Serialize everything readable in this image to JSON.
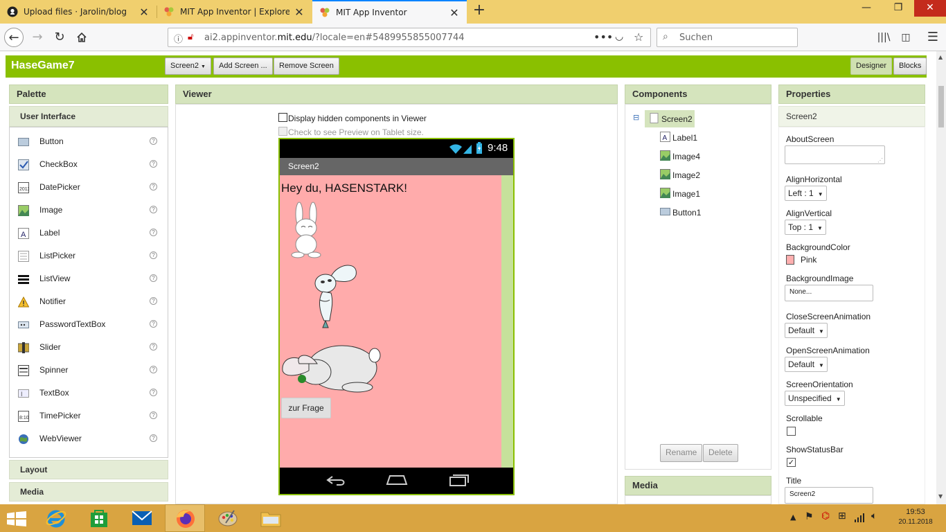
{
  "browser": {
    "tabs": [
      {
        "title": "Upload files · Jarolin/blog",
        "icon": "github-icon"
      },
      {
        "title": "MIT App Inventor | Explore MIT",
        "icon": "appinventor-icon"
      },
      {
        "title": "MIT App Inventor",
        "icon": "appinventor-icon"
      }
    ],
    "url_prefix": "ai2.appinventor.",
    "url_domain": "mit.edu",
    "url_suffix": "/?locale=en#5489955855007744",
    "search_placeholder": "Suchen"
  },
  "app": {
    "project_name": "HaseGame7",
    "screen_dropdown": "Screen2",
    "add_screen": "Add Screen ...",
    "remove_screen": "Remove Screen",
    "designer": "Designer",
    "blocks": "Blocks"
  },
  "palette": {
    "title": "Palette",
    "section": "User Interface",
    "items": [
      {
        "label": "Button",
        "icon": "button-icon"
      },
      {
        "label": "CheckBox",
        "icon": "checkbox-icon"
      },
      {
        "label": "DatePicker",
        "icon": "datepicker-icon"
      },
      {
        "label": "Image",
        "icon": "image-icon"
      },
      {
        "label": "Label",
        "icon": "label-icon"
      },
      {
        "label": "ListPicker",
        "icon": "listpicker-icon"
      },
      {
        "label": "ListView",
        "icon": "listview-icon"
      },
      {
        "label": "Notifier",
        "icon": "notifier-icon"
      },
      {
        "label": "PasswordTextBox",
        "icon": "passwordtextbox-icon"
      },
      {
        "label": "Slider",
        "icon": "slider-icon"
      },
      {
        "label": "Spinner",
        "icon": "spinner-icon"
      },
      {
        "label": "TextBox",
        "icon": "textbox-icon"
      },
      {
        "label": "TimePicker",
        "icon": "timepicker-icon"
      },
      {
        "label": "WebViewer",
        "icon": "webviewer-icon"
      }
    ],
    "help": "?",
    "layout": "Layout",
    "media": "Media"
  },
  "viewer": {
    "title": "Viewer",
    "hidden_components": "Display hidden components in Viewer",
    "tablet_preview": "Check to see Preview on Tablet size.",
    "status_time": "9:48",
    "screen_title": "Screen2",
    "label_text": "Hey du, HASENSTARK!",
    "button_text": "zur Frage"
  },
  "components": {
    "title": "Components",
    "collapse": "⊟",
    "root": "Screen2",
    "children": [
      "Label1",
      "Image4",
      "Image2",
      "Image1",
      "Button1"
    ],
    "rename": "Rename",
    "delete": "Delete",
    "media": "Media"
  },
  "properties": {
    "title": "Properties",
    "component": "Screen2",
    "about_screen": "AboutScreen",
    "align_horizontal": "AlignHorizontal",
    "align_horizontal_value": "Left : 1",
    "align_vertical": "AlignVertical",
    "align_vertical_value": "Top : 1",
    "background_color": "BackgroundColor",
    "background_color_value": "Pink",
    "background_color_hex": "#ffafaf",
    "background_image": "BackgroundImage",
    "background_image_value": "None...",
    "close_animation": "CloseScreenAnimation",
    "close_animation_value": "Default",
    "open_animation": "OpenScreenAnimation",
    "open_animation_value": "Default",
    "orientation": "ScreenOrientation",
    "orientation_value": "Unspecified",
    "scrollable": "Scrollable",
    "scrollable_checked": false,
    "show_status_bar": "ShowStatusBar",
    "show_status_bar_checked": true,
    "title_label": "Title",
    "title_value": "Screen2"
  },
  "taskbar": {
    "time": "19:53",
    "date": "20.11.2018"
  },
  "colors": {
    "accent": "#8ac000",
    "panel_header": "#d5e4bd",
    "screen_bg": "#ffabab",
    "taskbar": "#d9a441",
    "tabbar": "#f0cf6e"
  }
}
